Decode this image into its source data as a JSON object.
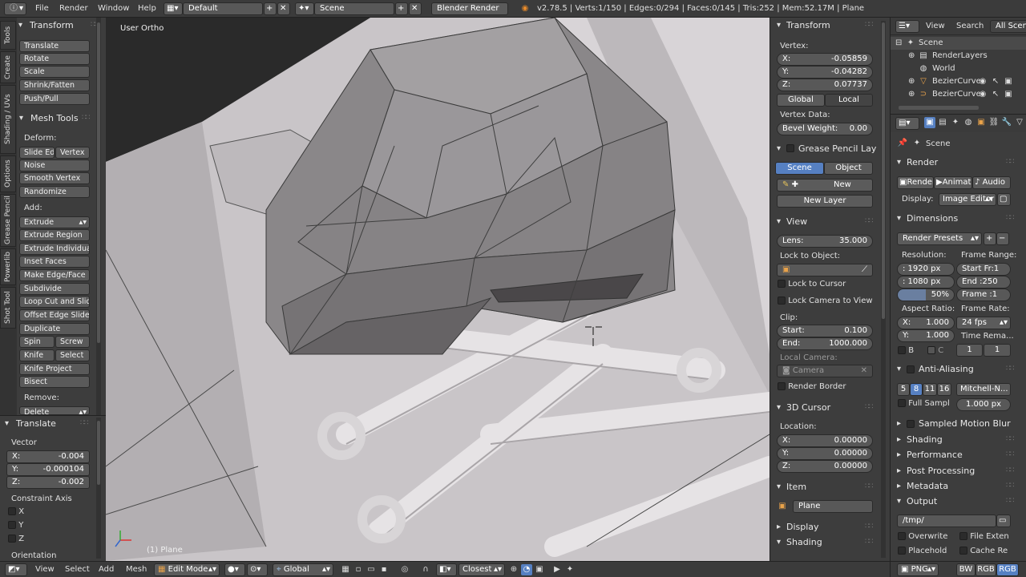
{
  "top": {
    "menus": [
      "File",
      "Render",
      "Window",
      "Help"
    ],
    "layout": "Default",
    "scene": "Scene",
    "engine": "Blender Render",
    "stats": "v2.78.5 | Verts:1/150 | Edges:0/294 | Faces:0/145 | Tris:252 | Mem:52.17M | Plane"
  },
  "tabs": [
    "Tools",
    "Create",
    "Shading / UVs",
    "Options",
    "Grease Pencil",
    "Powerlib",
    "Shot Tool"
  ],
  "tools": {
    "transform_header": "Transform",
    "transform": [
      "Translate",
      "Rotate",
      "Scale",
      "Shrink/Fatten",
      "Push/Pull"
    ],
    "mesh_header": "Mesh Tools",
    "deform_label": "Deform:",
    "slide_edge": "Slide Ed",
    "vertex": "Vertex",
    "deform": [
      "Noise",
      "Smooth Vertex",
      "Randomize"
    ],
    "add_label": "Add:",
    "extrude": "Extrude",
    "add": [
      "Extrude Region",
      "Extrude Individual",
      "Inset Faces",
      "Make Edge/Face",
      "Subdivide",
      "Loop Cut and Slide",
      "Offset Edge Slide",
      "Duplicate"
    ],
    "spin": "Spin",
    "screw": "Screw",
    "knife": "Knife",
    "select": "Select",
    "add2": [
      "Knife Project",
      "Bisect"
    ],
    "remove_label": "Remove:",
    "delete": "Delete"
  },
  "op": {
    "header": "Translate",
    "vector_label": "Vector",
    "x_label": "X:",
    "x": "-0.004",
    "y_label": "Y:",
    "y": "-0.000104",
    "z_label": "Z:",
    "z": "-0.002",
    "constraint_label": "Constraint Axis",
    "axes": [
      "X",
      "Y",
      "Z"
    ],
    "orientation_label": "Orientation"
  },
  "viewport": {
    "title": "User Ortho",
    "object": "(1) Plane"
  },
  "npanel": {
    "transform_header": "Transform",
    "vertex_label": "Vertex:",
    "vx_label": "X:",
    "vx": "-0.05859",
    "vy_label": "Y:",
    "vy": "-0.04282",
    "vz_label": "Z:",
    "vz": "0.07737",
    "global": "Global",
    "local": "Local",
    "vertex_data_label": "Vertex Data:",
    "bevel_label": "Bevel Weight:",
    "bevel": "0.00",
    "gp_header": "Grease Pencil Layers",
    "gp_scene": "Scene",
    "gp_object": "Object",
    "gp_new": "New",
    "gp_new_layer": "New Layer",
    "view_header": "View",
    "lens_label": "Lens:",
    "lens": "35.000",
    "lock_object_label": "Lock to Object:",
    "lock_cursor": "Lock to Cursor",
    "lock_camera": "Lock Camera to View",
    "clip_label": "Clip:",
    "clip_start_label": "Start:",
    "clip_start": "0.100",
    "clip_end_label": "End:",
    "clip_end": "1000.000",
    "local_camera_label": "Local Camera:",
    "camera": "Camera",
    "render_border": "Render Border",
    "cursor_header": "3D Cursor",
    "location_label": "Location:",
    "cx_label": "X:",
    "cx": "0.00000",
    "cy_label": "Y:",
    "cy": "0.00000",
    "cz_label": "Z:",
    "cz": "0.00000",
    "item_header": "Item",
    "item_name": "Plane",
    "display_header": "Display",
    "shading_header": "Shading"
  },
  "outliner": {
    "view": "View",
    "search": "Search",
    "scope": "All Scenes",
    "rows": [
      "Scene",
      "RenderLayers",
      "World",
      "BezierCurve",
      "BezierCurve"
    ]
  },
  "props": {
    "context": "Scene",
    "render_header": "Render",
    "render_btn": "Render",
    "animation_btn": "Animati",
    "audio_btn": "Audio",
    "display_label": "Display:",
    "display_value": "Image Editor",
    "dimensions_header": "Dimensions",
    "presets": "Render Presets",
    "resolution_label": "Resolution:",
    "frame_range_label": "Frame Range:",
    "res_x": ": 1920 px",
    "res_y": ": 1080 px",
    "res_pct": "50%",
    "start_frame": "Start Fr:1",
    "end_frame": "End :250",
    "frame": "Frame :1",
    "aspect_label": "Aspect Ratio:",
    "frame_rate_label": "Frame Rate:",
    "asp_x_label": "X:",
    "asp_x": "1.000",
    "asp_y_label": "Y:",
    "asp_y": "1.000",
    "fps": "24 fps",
    "time_remap_label": "Time Rema...",
    "b_label": "B",
    "c_label": "C",
    "remap_old": "1",
    "remap_new": "1",
    "aa_header": "Anti-Aliasing",
    "aa_samples": [
      "5",
      "8",
      "11",
      "16"
    ],
    "aa_filter": "Mitchell-N...",
    "full_sample": "Full Sampl",
    "filter_size": "1.000 px",
    "mblur_header": "Sampled Motion Blur",
    "collapsed": [
      "Shading",
      "Performance",
      "Post Processing",
      "Metadata"
    ],
    "output_header": "Output",
    "output_path": "/tmp/",
    "overwrite": "Overwrite",
    "file_ext": "File Exten",
    "placeholders": "Placehold",
    "cache": "Cache Re",
    "format": "PNG",
    "bw": "BW",
    "rgb": "RGB",
    "rgba": "RGB"
  },
  "bottom": {
    "view": "View",
    "select": "Select",
    "add": "Add",
    "mesh": "Mesh",
    "mode": "Edit Mode",
    "orientation": "Global",
    "snap": "Closest"
  },
  "colors": {
    "accent": "#5680c2",
    "header": "#3b3b3b",
    "panel": "#3d3d3d",
    "viewport_bg": "#3a3a3a"
  }
}
